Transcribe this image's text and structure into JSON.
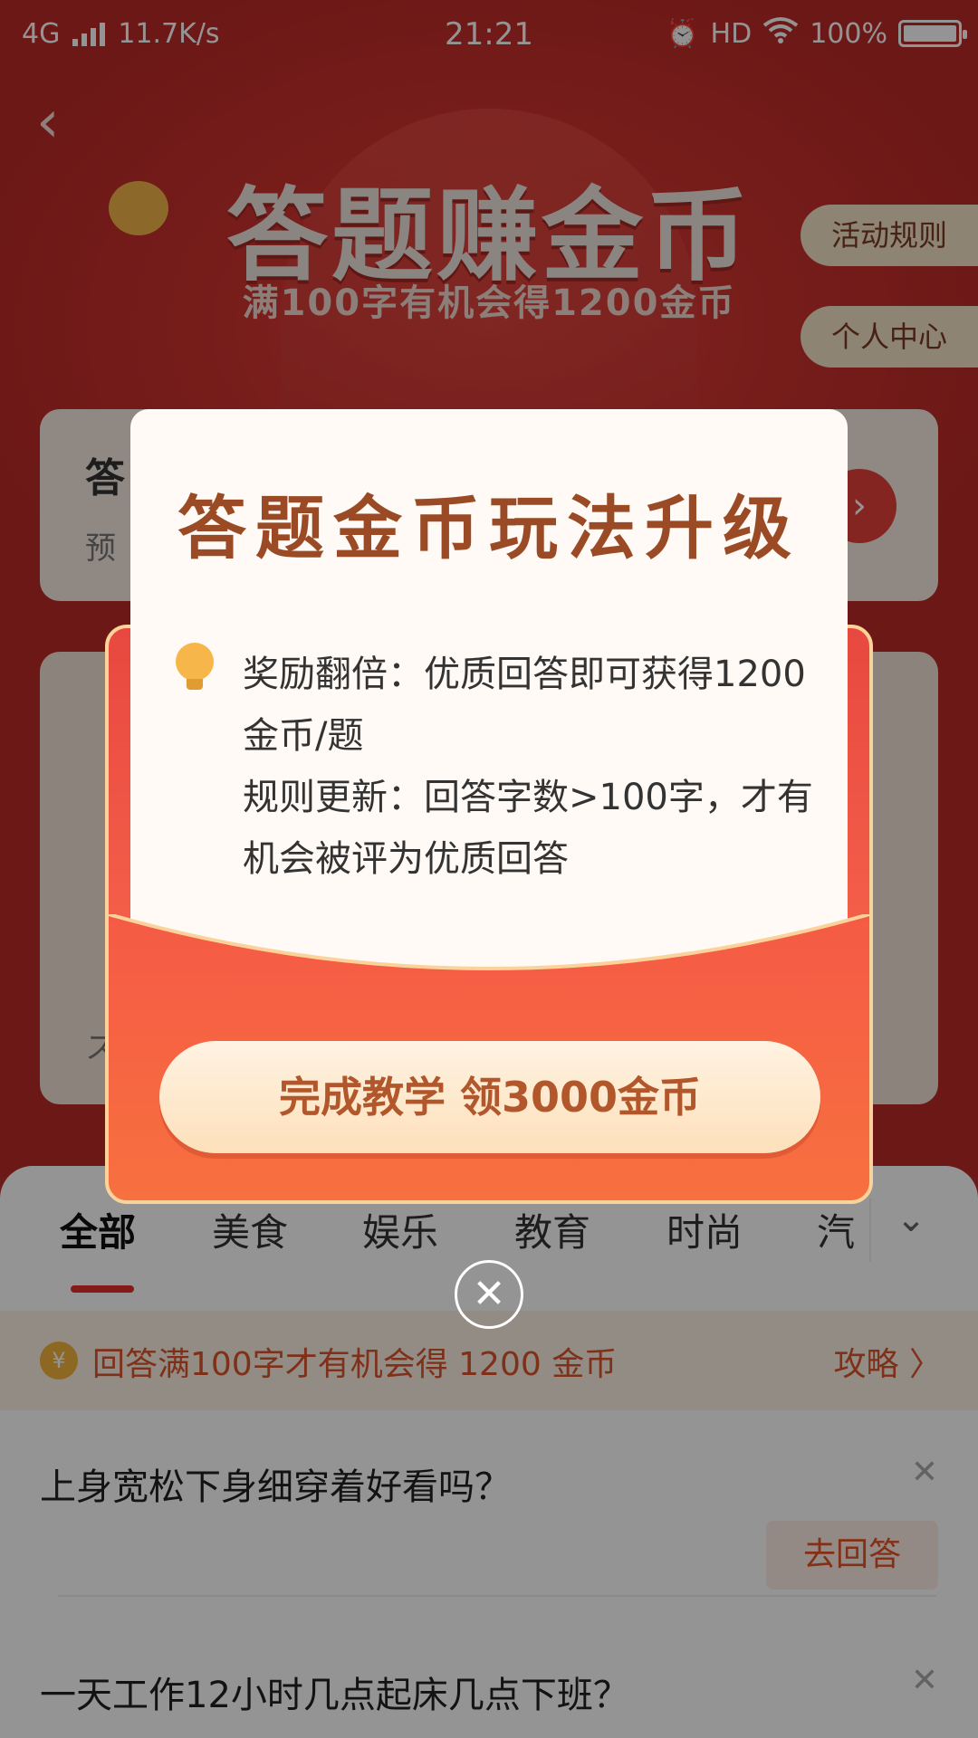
{
  "status_bar": {
    "network": "4G",
    "speed": "11.7K/s",
    "time": "21:21",
    "hd": "HD",
    "battery": "100%",
    "battery_level": 1.0
  },
  "header": {
    "title": "答题赚金币",
    "subtitle": "满100字有机会得1200金币",
    "rules_button": "活动规则",
    "profile_button": "个人中心"
  },
  "bg_cards": {
    "card1_title": "答",
    "card1_sub": "预",
    "card2_sub": "ス"
  },
  "tabs": {
    "items": [
      "全部",
      "美食",
      "娱乐",
      "教育",
      "时尚",
      "汽"
    ],
    "active": "全部"
  },
  "notice": {
    "coin_glyph": "¥",
    "text": "回答满100字才有机会得 1200 金币",
    "link": "攻略 〉"
  },
  "questions": [
    {
      "title": "上身宽松下身细穿着好看吗？",
      "answer_button": "去回答"
    },
    {
      "title": "一天工作12小时几点起床几点下班？",
      "answer_button": "去回答"
    }
  ],
  "modal": {
    "title": "答题金币玩法升级",
    "lines": [
      "奖励翻倍：优质回答即可获得1200",
      "金币/题",
      "规则更新：回答字数>100字，才有",
      "机会被评为优质回答"
    ],
    "cta": "完成教学 领3000金币",
    "close": "✕"
  },
  "colors": {
    "brand_red": "#e3302b",
    "modal_title": "#9a4b25",
    "cta_text": "#b2572b"
  }
}
